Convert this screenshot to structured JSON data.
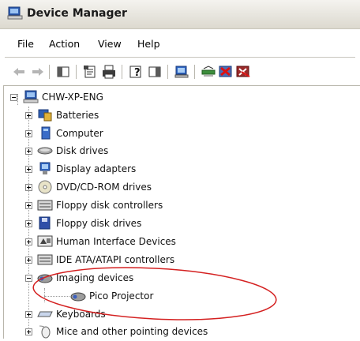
{
  "window": {
    "title": "Device Manager"
  },
  "menu": [
    "File",
    "Action",
    "View",
    "Help"
  ],
  "toolbar": {
    "buttons": [
      "back-arrow-icon",
      "forward-arrow-icon",
      "show-hide-console-tree-icon",
      "properties-icon",
      "print-icon",
      "help-icon",
      "show-hide-action-pane-icon",
      "scan-hardware-icon",
      "update-driver-icon",
      "disable-device-icon",
      "uninstall-device-icon"
    ]
  },
  "tree": {
    "root": {
      "label": "CHW-XP-ENG",
      "icon": "computer-icon"
    },
    "items": [
      {
        "label": "Batteries",
        "icon": "battery-icon",
        "expanded": false
      },
      {
        "label": "Computer",
        "icon": "computer-icon",
        "expanded": false
      },
      {
        "label": "Disk drives",
        "icon": "disk-drive-icon",
        "expanded": false
      },
      {
        "label": "Display adapters",
        "icon": "display-adapter-icon",
        "expanded": false
      },
      {
        "label": "DVD/CD-ROM drives",
        "icon": "dvd-drive-icon",
        "expanded": false
      },
      {
        "label": "Floppy disk controllers",
        "icon": "floppy-controller-icon",
        "expanded": false
      },
      {
        "label": "Floppy disk drives",
        "icon": "floppy-drive-icon",
        "expanded": false
      },
      {
        "label": "Human Interface Devices",
        "icon": "hid-icon",
        "expanded": false
      },
      {
        "label": "IDE ATA/ATAPI controllers",
        "icon": "ide-controller-icon",
        "expanded": false
      },
      {
        "label": "Imaging devices",
        "icon": "imaging-device-icon",
        "expanded": true,
        "children": [
          {
            "label": "Pico Projector",
            "icon": "projector-icon"
          }
        ]
      },
      {
        "label": "Keyboards",
        "icon": "keyboard-icon",
        "expanded": false
      },
      {
        "label": "Mice and other pointing devices",
        "icon": "mouse-icon",
        "expanded": false
      }
    ]
  },
  "annotation": {
    "color": "#d42020"
  }
}
